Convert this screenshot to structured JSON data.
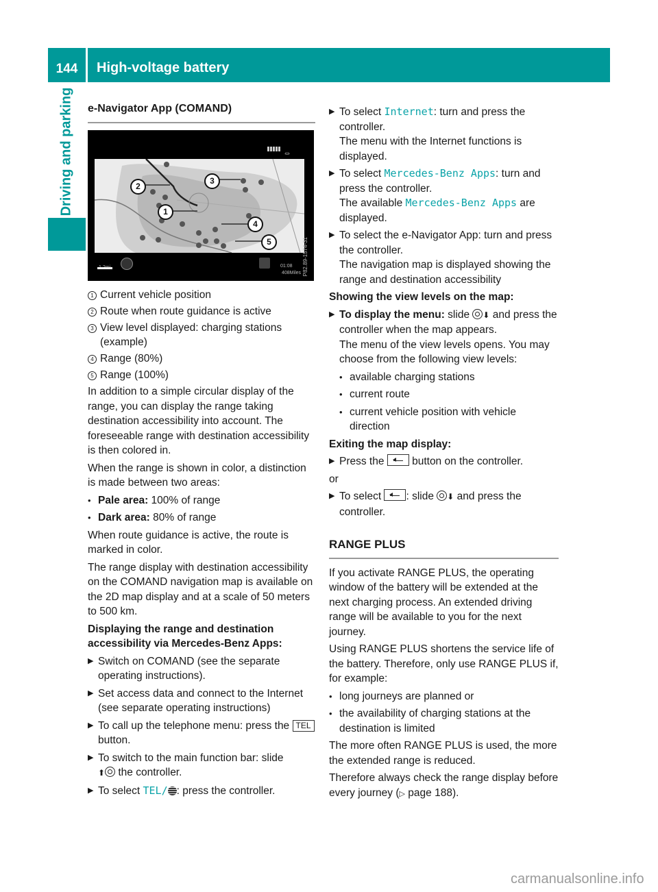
{
  "header": {
    "page_number": "144",
    "title": "High-voltage battery"
  },
  "side_tab": {
    "label": "Driving and parking"
  },
  "figure": {
    "section_title": "e-Navigator App (COMAND)",
    "callouts": [
      "1",
      "2",
      "3",
      "4",
      "5"
    ],
    "screen_time": "01:08",
    "screen_distance": "408Miles",
    "screen_scale": "1.2mi",
    "figure_code": "P82.89-1574-31",
    "icons": [
      "battery-icon",
      "plug-icon",
      "compass-icon",
      "destination-icon"
    ]
  },
  "legend": [
    {
      "num": "1",
      "text": "Current vehicle position"
    },
    {
      "num": "2",
      "text": "Route when route guidance is active"
    },
    {
      "num": "3",
      "text": "View level displayed: charging stations (example)"
    },
    {
      "num": "4",
      "text": "Range (80%)"
    },
    {
      "num": "5",
      "text": "Range (100%)"
    }
  ],
  "left_col": {
    "para1": "In addition to a simple circular display of the range, you can display the range taking destination accessibility into account. The foreseeable range with destination accessibility is then colored in.",
    "para2": "When the range is shown in color, a distinction is made between two areas:",
    "areas": [
      {
        "label": "Pale area:",
        "text": " 100% of range"
      },
      {
        "label": "Dark area:",
        "text": " 80% of range"
      }
    ],
    "para3": "When route guidance is active, the route is marked in color.",
    "para4": "The range display with destination accessibility on the COMAND navigation map is available on the 2D map display and at a scale of 50 meters to 500 km.",
    "subhead": "Displaying the range and destination accessibility via Mercedes-Benz Apps:",
    "steps": [
      {
        "text": "Switch on COMAND (see the separate operating instructions)."
      },
      {
        "text": "Set access data and connect to the Internet (see separate operating instructions)"
      },
      {
        "pre": "To call up the telephone menu: press the ",
        "key": "TEL",
        "post": " button."
      },
      {
        "pre": "To switch to the main function bar: slide ",
        "post": " the controller."
      },
      {
        "pre": "To select ",
        "menu": "TEL/",
        "post": ": press the controller."
      }
    ]
  },
  "right_col": {
    "steps_a": [
      {
        "pre": "To select ",
        "menu": "Internet",
        "post": ": turn and press the controller.",
        "result": "The menu with the Internet functions is displayed."
      },
      {
        "pre": "To select ",
        "menu": "Mercedes-Benz Apps",
        "post": ": turn and press the controller.",
        "result_pre": "The available ",
        "result_menu": "Mercedes-Benz Apps",
        "result_post": " are displayed."
      },
      {
        "text": "To select the e-Navigator App: turn and press the controller.",
        "result": "The navigation map is displayed showing the range and destination accessibility"
      }
    ],
    "view_levels_head": "Showing the view levels on the map:",
    "display_menu": {
      "bold": "To display the menu:",
      "pre": " slide ",
      "post": " and press the controller when the map appears.",
      "result": "The menu of the view levels opens. You may choose from the following view levels:"
    },
    "view_levels": [
      "available charging stations",
      "current route",
      "current vehicle position with vehicle direction"
    ],
    "exit_head": "Exiting the map display:",
    "exit_step1": {
      "pre": "Press the ",
      "post": " button on the controller."
    },
    "or": "or",
    "exit_step2": {
      "pre": "To select ",
      "mid": ": slide ",
      "post": " and press the controller."
    },
    "range_plus_title": "RANGE PLUS",
    "rp_para1": "If you activate RANGE PLUS, the operating window of the battery will be extended at the next charging process. An extended driving range will be available to you for the next journey.",
    "rp_para2": "Using RANGE PLUS shortens the service life of the battery. Therefore, only use RANGE PLUS if, for example:",
    "rp_bullets": [
      "long journeys are planned or",
      "the availability of charging stations at the destination is limited"
    ],
    "rp_para3": "The more often RANGE PLUS is used, the more the extended range is reduced.",
    "rp_para4_pre": "Therefore always check the range display before every journey (",
    "rp_page_ref": "page 188",
    "rp_para4_post": ")."
  },
  "watermark": "carmanualsonline.info",
  "colors": {
    "brand_teal": "#009999",
    "menu_text_teal": "#0aa3a8"
  }
}
